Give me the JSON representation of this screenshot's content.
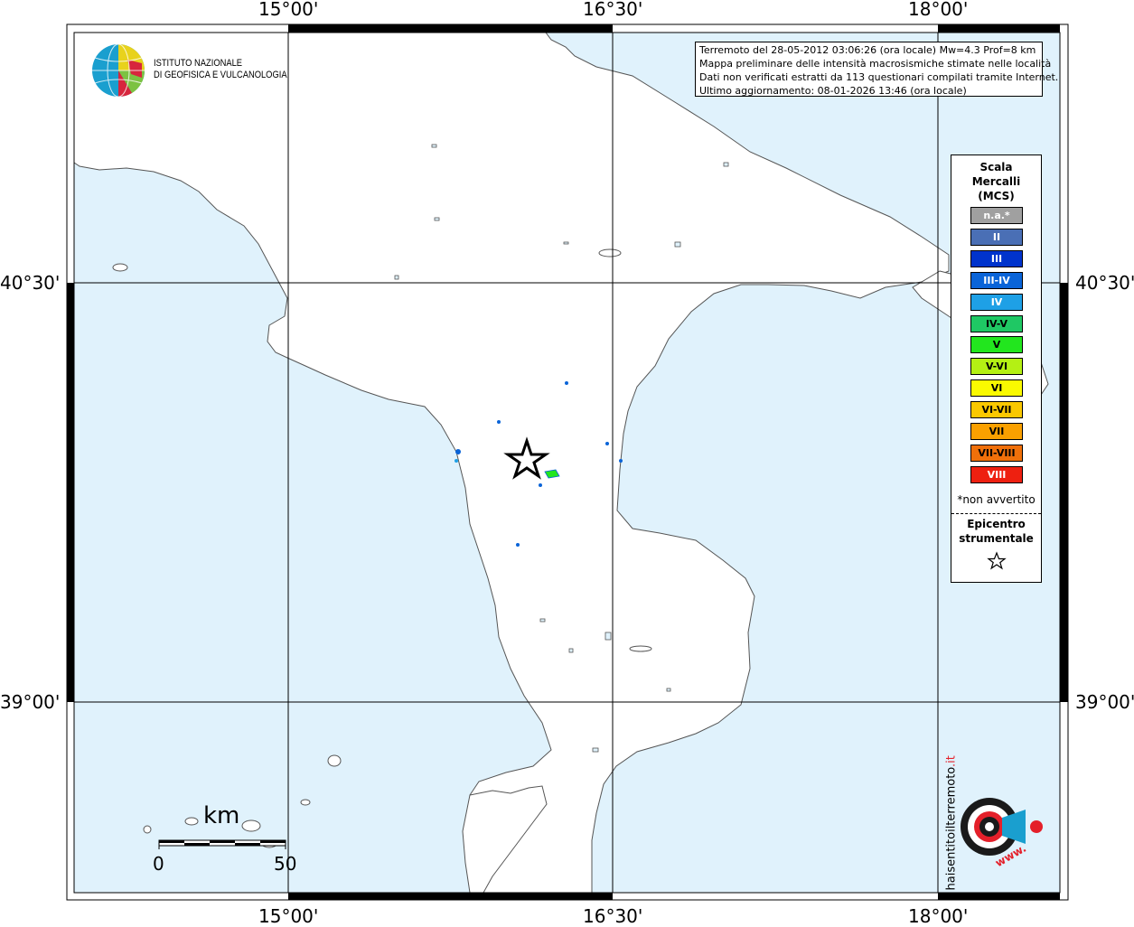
{
  "axes": {
    "top_lon_labels": [
      "15°00'",
      "16°30'",
      "18°00'"
    ],
    "bottom_lon_labels": [
      "15°00'",
      "16°30'",
      "18°00'"
    ],
    "left_lat_labels": [
      "40°30'",
      "39°00'"
    ],
    "right_lat_labels": [
      "40°30'",
      "39°00'"
    ]
  },
  "colors": {
    "sea": "#e0f2fc",
    "land": "#ffffff",
    "coast": "#555555",
    "grid": "#000000"
  },
  "logo": {
    "icon": "ingv-globe-icon",
    "line1": "ISTITUTO NAZIONALE",
    "line2": "DI GEOFISICA E VULCANOLOGIA"
  },
  "info": {
    "line1": "Terremoto del 28-05-2012 03:06:26 (ora locale) Mw=4.3 Prof=8 km",
    "line2": "Mappa preliminare delle intensità macrosismiche stimate nelle località",
    "line3": "Dati non verificati estratti da 113 questionari compilati tramite Internet.",
    "line4": "Ultimo aggiornamento: 08-01-2026 13:46 (ora locale)"
  },
  "legend": {
    "title1": "Scala",
    "title2": "Mercalli",
    "title3": "(MCS)",
    "items": [
      {
        "label": "n.a.*",
        "color": "#a0a0a0",
        "text_color": "#ffffff"
      },
      {
        "label": "II",
        "color": "#4a6fb5",
        "text_color": "#ffffff"
      },
      {
        "label": "III",
        "color": "#0033cc",
        "text_color": "#ffffff"
      },
      {
        "label": "III-IV",
        "color": "#0a64d8",
        "text_color": "#ffffff"
      },
      {
        "label": "IV",
        "color": "#1ea0e6",
        "text_color": "#ffffff"
      },
      {
        "label": "IV-V",
        "color": "#1fc864",
        "text_color": "#000000"
      },
      {
        "label": "V",
        "color": "#22e61e",
        "text_color": "#000000"
      },
      {
        "label": "V-VI",
        "color": "#b4f014",
        "text_color": "#000000"
      },
      {
        "label": "VI",
        "color": "#fafa00",
        "text_color": "#000000"
      },
      {
        "label": "VI-VII",
        "color": "#fac800",
        "text_color": "#000000"
      },
      {
        "label": "VII",
        "color": "#faa000",
        "text_color": "#000000"
      },
      {
        "label": "VII-VIII",
        "color": "#f0700a",
        "text_color": "#000000"
      },
      {
        "label": "VIII",
        "color": "#ee2010",
        "text_color": "#ffffff"
      }
    ],
    "note": "*non avvertito",
    "epicenter1": "Epicentro",
    "epicenter2": "strumentale",
    "epicenter_icon": "star-icon"
  },
  "scale_bar": {
    "unit": "km",
    "start": "0",
    "end": "50"
  },
  "hst_logo": {
    "text_main": "haisentitoilterremoto",
    "text_tld": ".it",
    "text_www": "www.",
    "icon": "target-megaphone-icon"
  }
}
